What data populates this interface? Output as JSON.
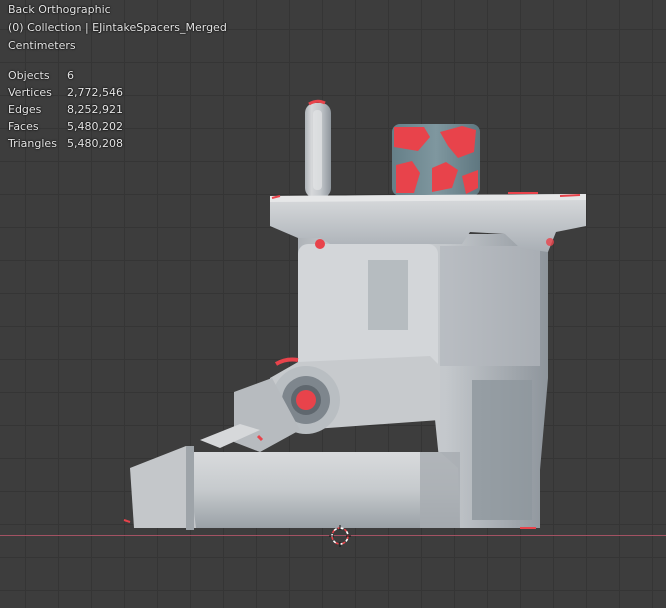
{
  "viewport": {
    "view_name": "Back Orthographic",
    "collection_line": "(0) Collection | EJintakeSpacers_Merged",
    "units": "Centimeters",
    "stats": [
      {
        "label": "Objects",
        "value": "6"
      },
      {
        "label": "Vertices",
        "value": "2,772,546"
      },
      {
        "label": "Edges",
        "value": "8,252,921"
      },
      {
        "label": "Faces",
        "value": "5,480,202"
      },
      {
        "label": "Triangles",
        "value": "5,480,208"
      }
    ]
  },
  "colors": {
    "background": "#3d3d3d",
    "grid_line": "#353535",
    "x_axis": "#b5566a",
    "mesh_base": "#c9ccce",
    "mesh_shadow": "#8d949b",
    "highlight_red": "#e8434b",
    "teal_part": "#6f8a93"
  },
  "icons": {
    "cursor": "3d-cursor-icon"
  }
}
